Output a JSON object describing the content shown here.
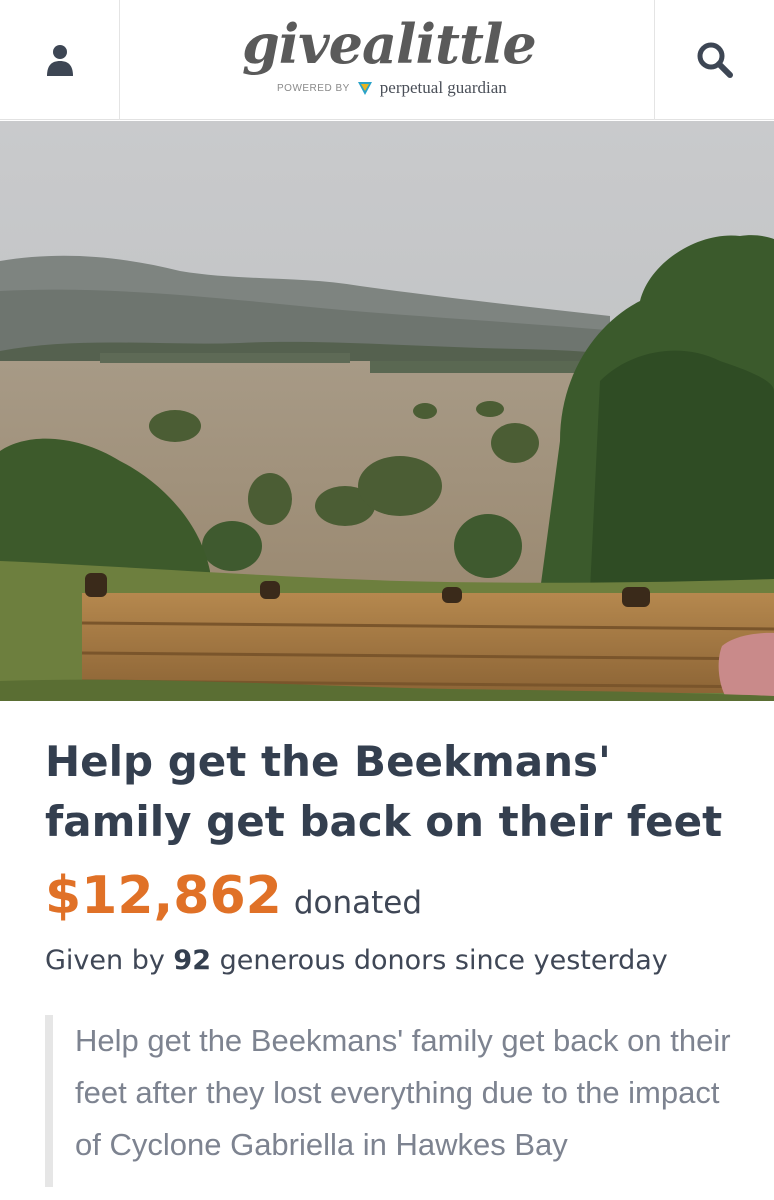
{
  "header": {
    "logo_text": "givealittle",
    "powered_by": "POWERED BY",
    "partner": "perpetual guardian",
    "icons": {
      "account": "user-icon",
      "search": "search-icon"
    }
  },
  "hero": {
    "image": "flooded-landscape-photo"
  },
  "campaign": {
    "title": "Help get the Beekmans' family get back on their feet",
    "amount": "$12,862",
    "amount_suffix": "donated",
    "given_prefix": "Given by",
    "donor_count": "92",
    "given_suffix": "generous donors since yesterday",
    "description": "Help get the Beekmans' family get back on their feet after they lost everything due to the impact of Cyclone Gabriella in Hawkes Bay"
  },
  "colors": {
    "accent": "#e07127",
    "title": "#343f4f",
    "body": "#3f4756",
    "muted": "#7d8390"
  }
}
